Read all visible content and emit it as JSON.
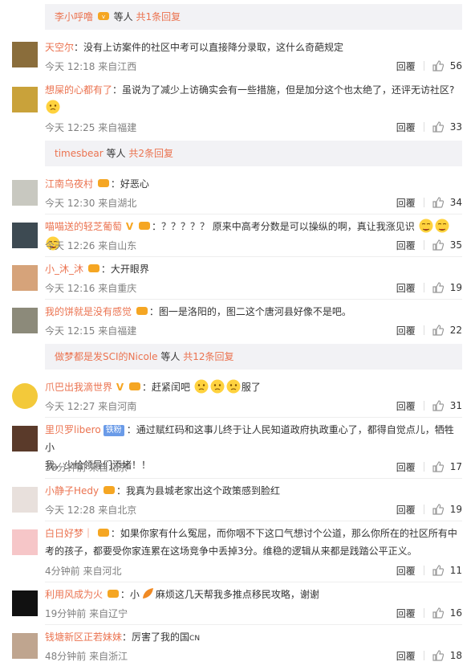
{
  "reply_bars": [
    {
      "name": "李小呼噜",
      "suffix": "等人",
      "link": "共1条回复"
    },
    {
      "name": "timesbear",
      "suffix": "等人",
      "link": "共2条回复"
    },
    {
      "name": "做梦都是发SCI的Nicole",
      "suffix": "等人",
      "link": "共12条回复"
    }
  ],
  "reply_label": "回覆",
  "comments": [
    {
      "user": "天空尔",
      "text": "没有上访案件的社区中考可以直接降分录取，这什么奇葩规定",
      "time": "今天 12:18",
      "loc": "来自江西",
      "likes": "56",
      "avatar_color": "#8a6d3b"
    },
    {
      "user": "想屎的心都有了",
      "text": "虽说为了减少上访确实会有一些措施，但是加分这个也太绝了，还评无访社区?",
      "time": "今天 12:25",
      "loc": "来自福建",
      "likes": "33",
      "avatar_color": "#c9a23a"
    },
    {
      "user": "江南乌夜村",
      "text": "好恶心",
      "time": "今天 12:30",
      "loc": "来自湖北",
      "likes": "34",
      "avatar_color": "#c8c8c0"
    },
    {
      "user": "喵喵送的轻芝葡萄",
      "text": "？？？？？ 原来中高考分数是可以操纵的啊，真让我涨见识",
      "time": "今天 12:26",
      "loc": "来自山东",
      "likes": "35",
      "avatar_color": "#3d4a52"
    },
    {
      "user": "小_沐_沐",
      "text": "大开眼界",
      "time": "今天 12:16",
      "loc": "来自重庆",
      "likes": "19",
      "avatar_color": "#d6a37a"
    },
    {
      "user": "我的饼就是没有感觉",
      "text": "图一是洛阳的，图二这个唐河县好像不是吧。",
      "time": "今天 12:15",
      "loc": "来自福建",
      "likes": "22",
      "avatar_color": "#8c8a7a"
    },
    {
      "user": "爪巴出我滴世界",
      "text": "赶紧闰吧",
      "text2": "服了",
      "time": "今天 12:27",
      "loc": "来自河南",
      "likes": "31",
      "avatar_color": "#f3c93a"
    },
    {
      "user": "里贝罗libero",
      "fans": "铁粉",
      "text": "通过赋红码和这事儿终于让人民知道政府执政重心了，都得自觉点儿，牺牲小",
      "text_line2": "我，少给领导们添堵！！",
      "time": "38分钟前",
      "loc": "来自北京",
      "likes": "17",
      "avatar_color": "#5a3a2a"
    },
    {
      "user": "小静子Hedy",
      "text": "我真为县城老家出这个政策感到脸红",
      "time": "今天 12:28",
      "loc": "来自北京",
      "likes": "19",
      "avatar_color": "#e8e0dc"
    },
    {
      "user": "白日好梦｜",
      "text": "如果你家有什么冤屈，而你咽不下这口气想讨个公道，那么你所在的社区所有中",
      "text_line2": "考的孩子，都要受你家连累在这场竞争中丢掉3分。维稳的逻辑从来都是践踏公平正义。",
      "time": "4分钟前",
      "loc": "来自河北",
      "likes": "11",
      "avatar_color": "#f6c6c8"
    },
    {
      "user": "利用风成为火",
      "text": "小",
      "text2": "麻烦这几天帮我多推点移民攻略，谢谢",
      "time": "19分钟前",
      "loc": "来自辽宁",
      "likes": "16",
      "avatar_color": "#111111"
    },
    {
      "user": "钱塘新区正若妹妹",
      "text": "厉害了我的国",
      "text_suffix": "CN",
      "time": "48分钟前",
      "loc": "来自浙江",
      "likes": "18",
      "avatar_color": "#bfa58f"
    }
  ]
}
